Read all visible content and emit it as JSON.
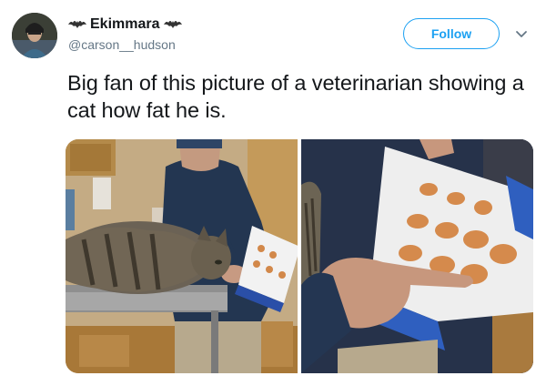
{
  "user": {
    "display_name": "Ekimmara",
    "handle": "@carson__hudson",
    "avatar": "avatar-photo",
    "name_badge": "bat-emoji"
  },
  "actions": {
    "follow_label": "Follow",
    "menu_icon": "chevron-down-icon"
  },
  "tweet": {
    "text": "Big fan of this picture of a veterinarian showing a cat how fat he is."
  },
  "media": {
    "images": [
      {
        "name": "vet-with-cat-photo"
      },
      {
        "name": "cat-weight-chart-closeup-photo"
      }
    ]
  },
  "colors": {
    "accent": "#1da1f2",
    "secondary_text": "#657786",
    "primary_text": "#14171a"
  }
}
